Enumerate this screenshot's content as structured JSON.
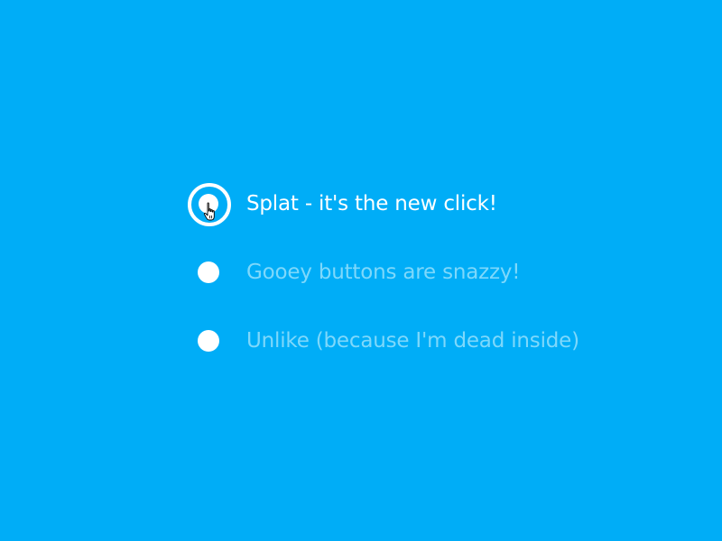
{
  "options": [
    {
      "label": "Splat - it's the new click!",
      "selected": true
    },
    {
      "label": "Gooey buttons are snazzy!",
      "selected": false
    },
    {
      "label": "Unlike (because I'm dead inside)",
      "selected": false
    }
  ],
  "colors": {
    "background": "#00ADF7",
    "selected_text": "#FFFFFF",
    "unselected_text": "#7ED8FB",
    "radio": "#FFFFFF"
  },
  "icons": {
    "cursor": "hand-pointer-icon"
  }
}
